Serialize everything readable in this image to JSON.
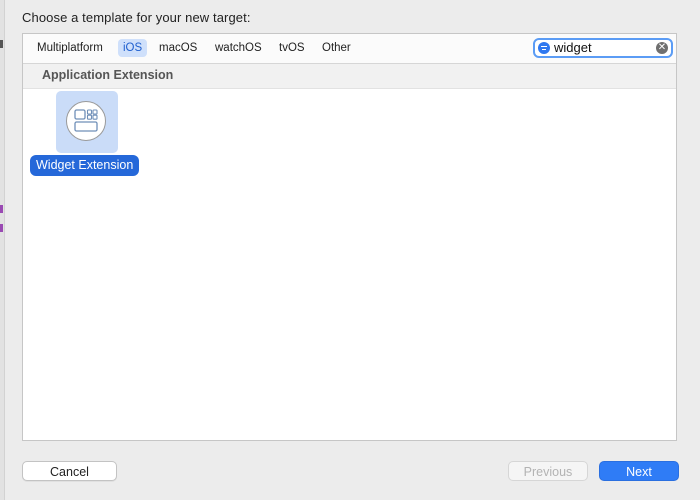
{
  "sheet": {
    "title": "Choose a template for your new target:"
  },
  "tabs": [
    {
      "label": "Multiplatform",
      "selected": false
    },
    {
      "label": "iOS",
      "selected": true
    },
    {
      "label": "macOS",
      "selected": false
    },
    {
      "label": "watchOS",
      "selected": false
    },
    {
      "label": "tvOS",
      "selected": false
    },
    {
      "label": "Other",
      "selected": false
    }
  ],
  "search": {
    "value": "widget",
    "icon": "filter-icon",
    "clear_icon": "clear-icon"
  },
  "section": {
    "title": "Application Extension"
  },
  "templates": [
    {
      "label": "Widget Extension",
      "selected": true,
      "icon": "widget-extension-icon"
    }
  ],
  "buttons": {
    "cancel": "Cancel",
    "previous": "Previous",
    "next": "Next"
  },
  "colors": {
    "accent": "#2f7cf6",
    "selected_tile": "#cadcf8",
    "selected_label": "#2568d9",
    "tab_selected_bg": "#cfe0fb"
  }
}
